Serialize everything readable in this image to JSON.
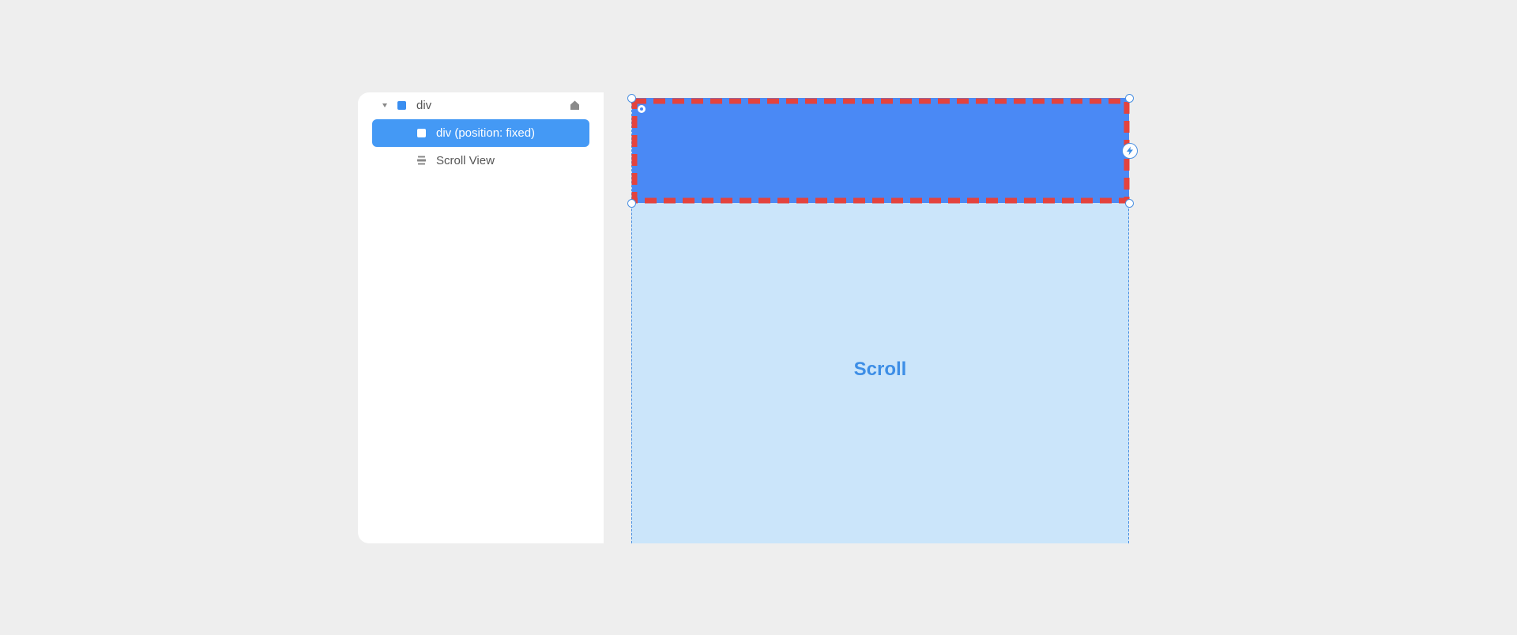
{
  "layers": {
    "root": {
      "label": "div",
      "icon": "home-icon"
    },
    "items": [
      {
        "label": "div (position: fixed)",
        "selected": true,
        "icon": "square-icon"
      },
      {
        "label": "Scroll View",
        "selected": false,
        "icon": "stack-icon"
      }
    ]
  },
  "canvas": {
    "scroll_label": "Scroll"
  },
  "colors": {
    "selection": "#4499f5",
    "fixed_fill": "#4a89f5",
    "scroll_fill": "#cbe5fa",
    "dashed_outline": "#e3433e"
  }
}
